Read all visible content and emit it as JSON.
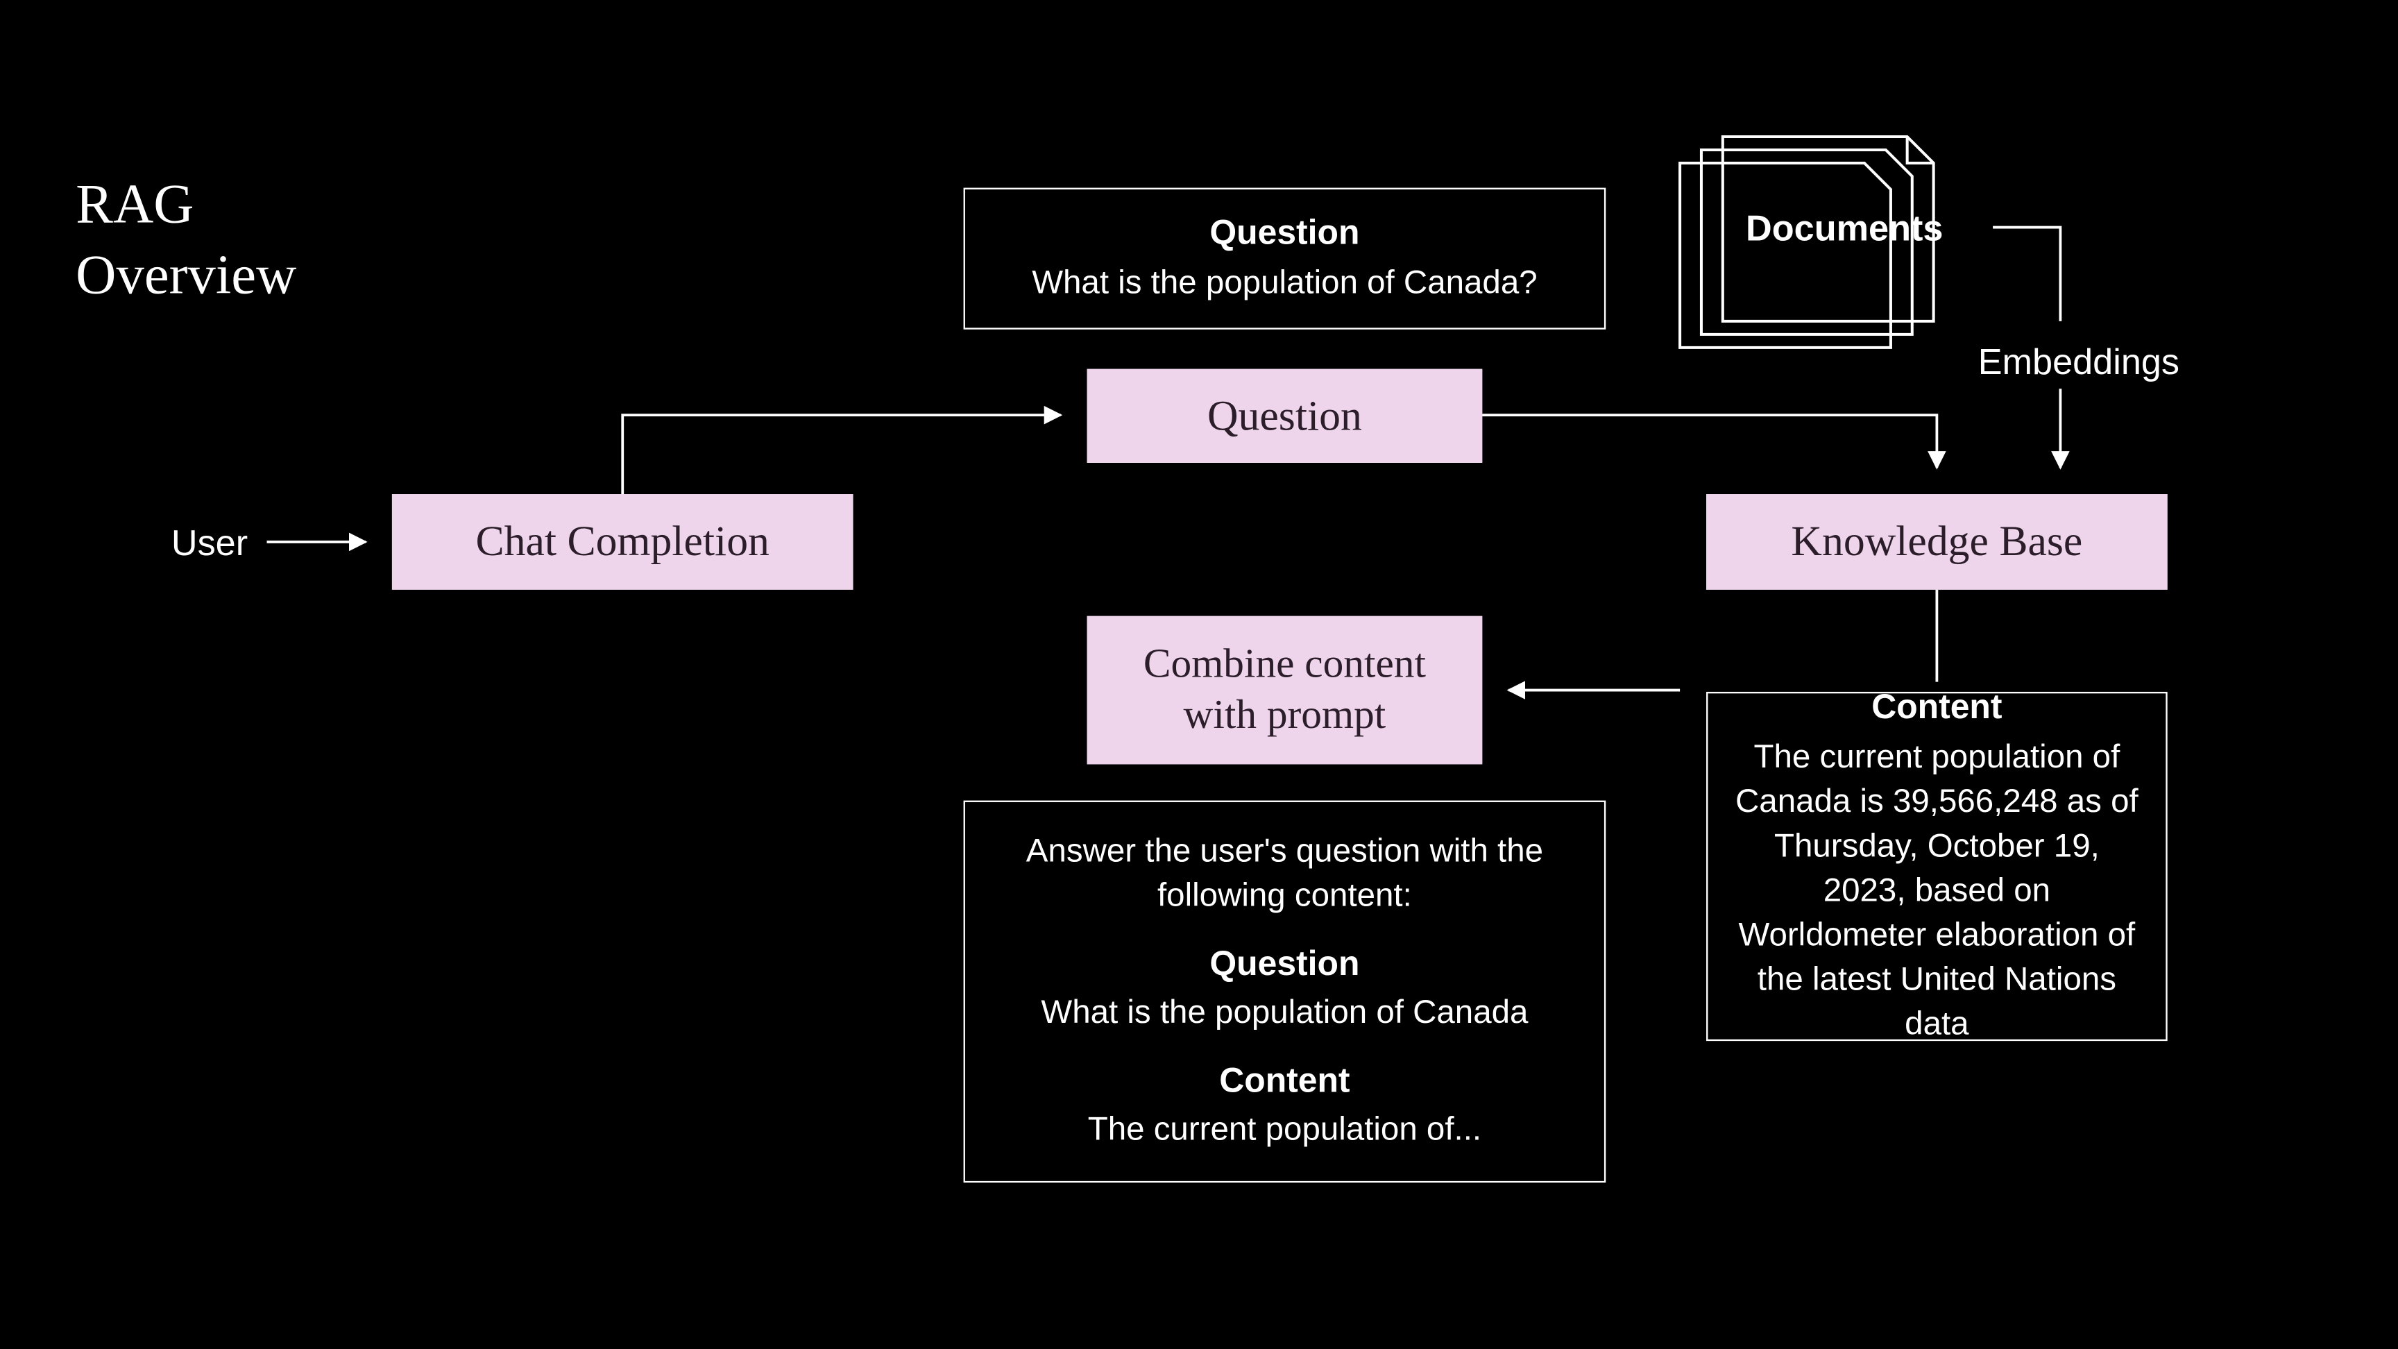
{
  "title": {
    "line1": "RAG",
    "line2": "Overview"
  },
  "labels": {
    "user": "User",
    "embeddings": "Embeddings",
    "documents": "Documents"
  },
  "nodes": {
    "chatCompletion": "Chat Completion",
    "question": "Question",
    "knowledgeBase": "Knowledge Base",
    "combine": {
      "line1": "Combine content",
      "line2": "with prompt"
    }
  },
  "questionBox": {
    "header": "Question",
    "body": "What is the population of Canada?"
  },
  "contentBox": {
    "header": "Content",
    "body": "The current population of Canada is 39,566,248 as of Thursday, October 19, 2023, based on Worldometer elaboration of the latest United Nations data"
  },
  "promptBox": {
    "intro": "Answer the user's question with the following content:",
    "qHeader": "Question",
    "qBody": "What is the population of Canada",
    "cHeader": "Content",
    "cBody": "The current population of..."
  }
}
